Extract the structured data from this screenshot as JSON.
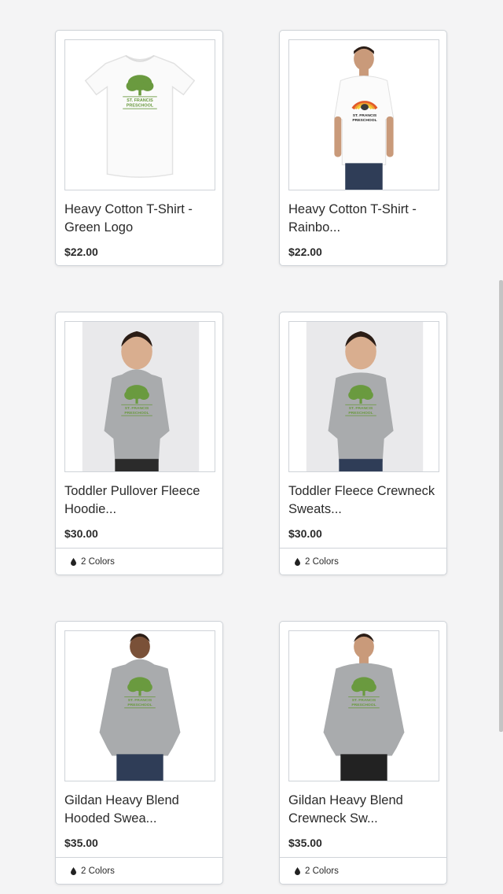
{
  "products": [
    {
      "name": "Heavy Cotton T-Shirt - Green Logo",
      "name_display": "Heavy Cotton T-Shirt -\nGreen Logo",
      "price": "$22.00",
      "colors": null,
      "image": "white-tshirt-green-logo"
    },
    {
      "name": "Heavy Cotton T-Shirt - Rainbo...",
      "name_display": "Heavy Cotton T-Shirt -\nRainbo...",
      "price": "$22.00",
      "colors": null,
      "image": "man-white-tshirt-rainbow-logo"
    },
    {
      "name": "Toddler Pullover Fleece Hoodie...",
      "name_display": "Toddler Pullover Fleece\nHoodie...",
      "price": "$30.00",
      "colors": "2 Colors",
      "image": "girl-gray-hoodie"
    },
    {
      "name": "Toddler Fleece Crewneck Sweats...",
      "name_display": "Toddler Fleece Crewneck\nSweats...",
      "price": "$30.00",
      "colors": "2 Colors",
      "image": "boy-gray-crewneck"
    },
    {
      "name": "Gildan Heavy Blend Hooded Swea...",
      "name_display": "Gildan Heavy Blend\nHooded Swea...",
      "price": "$35.00",
      "colors": "2 Colors",
      "image": "man-gray-hoodie"
    },
    {
      "name": "Gildan Heavy Blend Crewneck Sw...",
      "name_display": "Gildan Heavy Blend\nCrewneck Sw...",
      "price": "$35.00",
      "colors": "2 Colors",
      "image": "man-gray-crewneck"
    }
  ],
  "logo_text": {
    "line1": "ST. FRANCIS",
    "line2": "PRESCHOOL"
  },
  "theme": {
    "logo_green": "#6a9a3f",
    "heather_gray": "#a9abad",
    "border": "#cfd3d8"
  }
}
